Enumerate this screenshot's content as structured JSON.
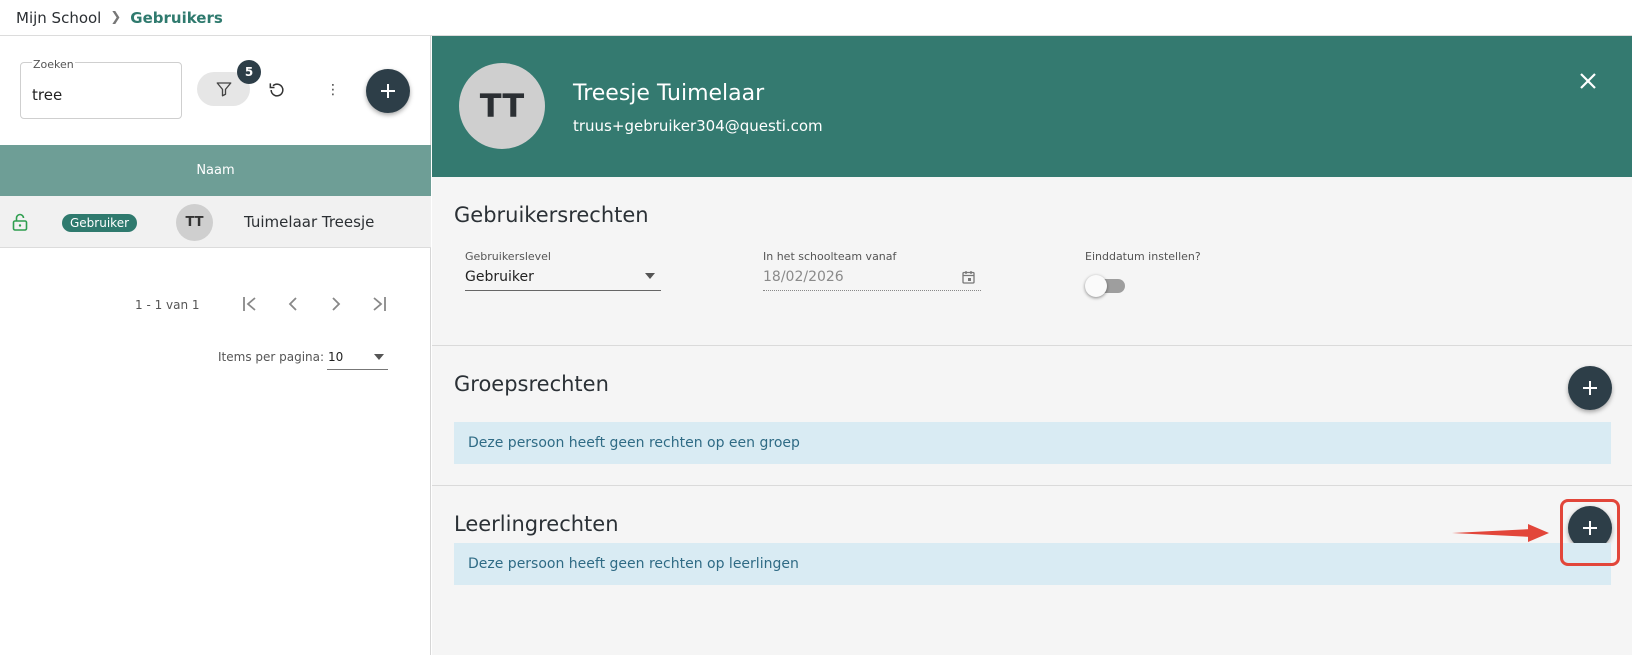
{
  "breadcrumb": {
    "root": "Mijn School",
    "current": "Gebruikers"
  },
  "search": {
    "label": "Zoeken",
    "value": "tree"
  },
  "filter": {
    "count": "5"
  },
  "table": {
    "column_header": "Naam",
    "rows": [
      {
        "role": "Gebruiker",
        "initials": "TT",
        "name": "Tuimelaar Treesje",
        "locked": true
      }
    ]
  },
  "pagination": {
    "range": "1 - 1 van 1",
    "items_per_page_label": "Items per pagina:",
    "items_per_page": "10"
  },
  "user": {
    "initials": "TT",
    "name": "Treesje Tuimelaar",
    "email": "truus+gebruiker304@questi.com"
  },
  "rights": {
    "title": "Gebruikersrechten",
    "level_label": "Gebruikerslevel",
    "level_value": "Gebruiker",
    "team_label": "In het schoolteam vanaf",
    "team_value": "18/02/2026",
    "enddate_label": "Einddatum instellen?",
    "enddate_enabled": false
  },
  "group_rights": {
    "title": "Groepsrechten",
    "empty": "Deze persoon heeft geen rechten op een groep"
  },
  "student_rights": {
    "title": "Leerlingrechten",
    "empty": "Deze persoon heeft geen rechten op leerlingen"
  },
  "colors": {
    "header": "#347a70",
    "accent": "#2f7a6e",
    "fab": "#2d3e48",
    "table_header": "#6e9e96",
    "highlight": "#e2463a",
    "info_bg": "#d9ebf3"
  },
  "icons": [
    "chevron-right-icon",
    "filter-icon",
    "reset-icon",
    "more-vert-icon",
    "plus-icon",
    "lock-open-icon",
    "first-page-icon",
    "prev-page-icon",
    "next-page-icon",
    "last-page-icon",
    "close-icon",
    "calendar-icon",
    "arrow-icon"
  ]
}
